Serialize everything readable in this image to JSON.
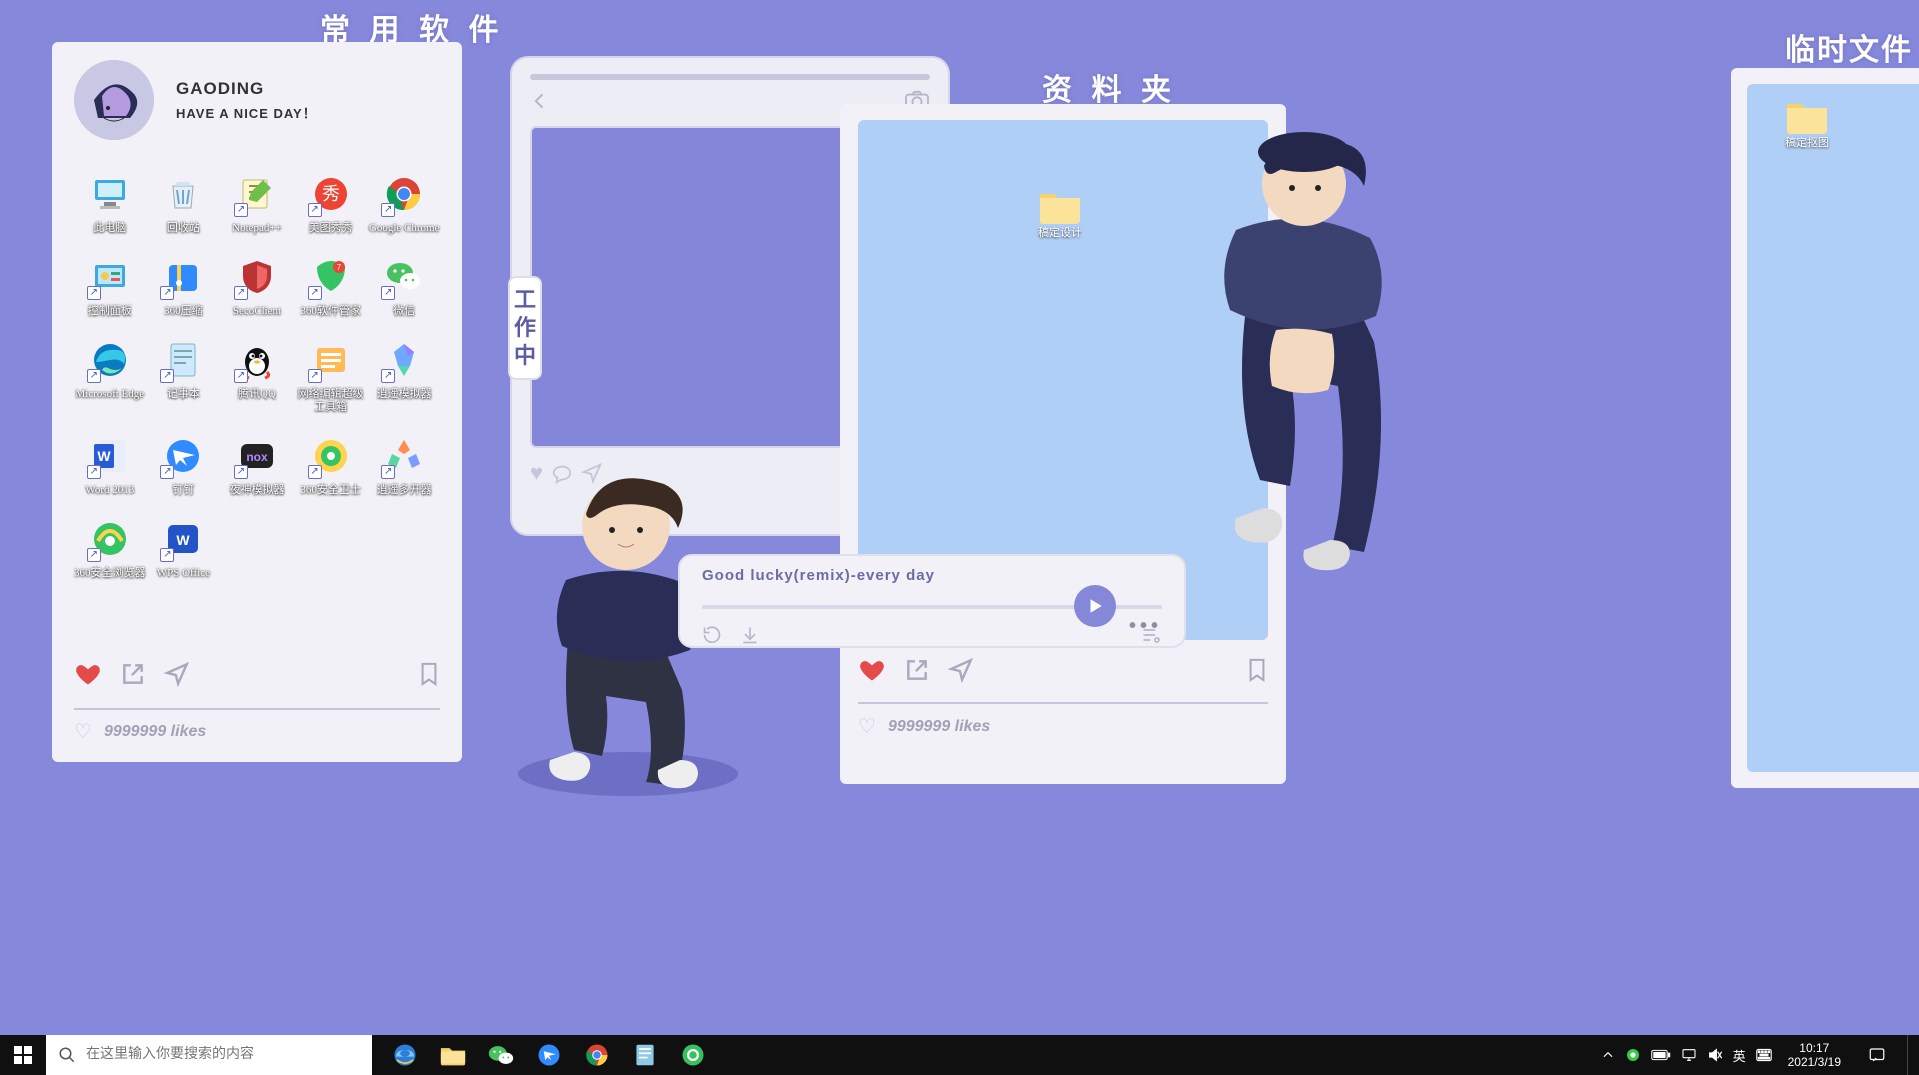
{
  "titles": {
    "apps": "常 用 软 件",
    "work": "工\n作\n中",
    "folder": "资 料 夹",
    "temp": "临时文件"
  },
  "profile": {
    "name": "GAODING",
    "subtitle": "HAVE A NICE DAY！"
  },
  "icons": [
    {
      "label": "此电脑",
      "type": "pc"
    },
    {
      "label": "回收站",
      "type": "recycle"
    },
    {
      "label": "Notepad++",
      "type": "npp"
    },
    {
      "label": "美图秀秀",
      "type": "meitu"
    },
    {
      "label": "Google Chrome",
      "type": "chrome"
    },
    {
      "label": "控制面板",
      "type": "cpanel"
    },
    {
      "label": "360压缩",
      "type": "360zip"
    },
    {
      "label": "SecoClient",
      "type": "shield"
    },
    {
      "label": "360软件管家",
      "type": "360soft"
    },
    {
      "label": "微信",
      "type": "wechat"
    },
    {
      "label": "Microsoft Edge",
      "type": "edge"
    },
    {
      "label": "记事本",
      "type": "notepad"
    },
    {
      "label": "腾讯QQ",
      "type": "qq"
    },
    {
      "label": "网络编辑超级工具箱",
      "type": "tool"
    },
    {
      "label": "逍遥模拟器",
      "type": "sim1"
    },
    {
      "label": "Word 2013",
      "type": "word"
    },
    {
      "label": "钉钉",
      "type": "ding"
    },
    {
      "label": "夜神模拟器",
      "type": "nox"
    },
    {
      "label": "360安全卫士",
      "type": "360safe"
    },
    {
      "label": "逍遥多开器",
      "type": "sim2"
    },
    {
      "label": "360安全浏览器",
      "type": "360br"
    },
    {
      "label": "WPS Office",
      "type": "wps"
    }
  ],
  "likes": "9999999 likes",
  "folder": {
    "item": "稿定设计"
  },
  "temp": {
    "item": "稿定抠图"
  },
  "player": {
    "title": "Good lucky(remix)-every day"
  },
  "taskbar": {
    "search_placeholder": "在这里输入你要搜索的内容",
    "ime1": "英",
    "ime2": "⌨",
    "time": "10:17",
    "date": "2021/3/19"
  }
}
